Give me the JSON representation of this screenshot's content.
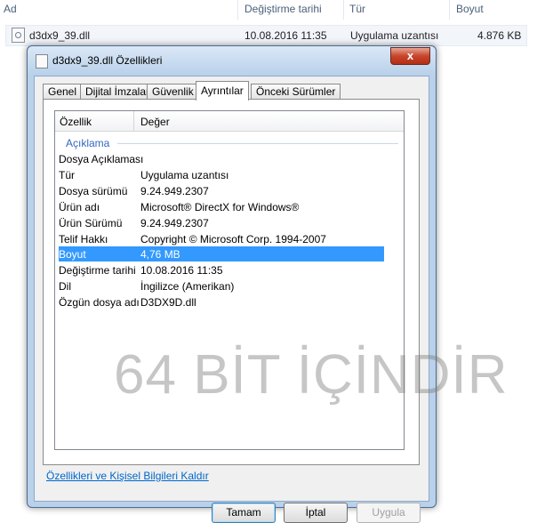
{
  "explorer": {
    "columns": [
      "Ad",
      "Değiştirme tarihi",
      "Tür",
      "Boyut"
    ],
    "row": {
      "name": "d3dx9_39.dll",
      "modified": "10.08.2016 11:35",
      "type": "Uygulama uzantısı",
      "size": "4.876 KB"
    }
  },
  "dialog": {
    "title": "d3dx9_39.dll Özellikleri",
    "close_label": "x",
    "tabs": [
      "Genel",
      "Dijital İmzalar",
      "Güvenlik",
      "Ayrıntılar",
      "Önceki Sürümler"
    ],
    "active_tab": "Ayrıntılar",
    "list_header": {
      "property": "Özellik",
      "value": "Değer"
    },
    "group_label": "Açıklama",
    "properties": [
      {
        "key": "Dosya Açıklaması",
        "value": ""
      },
      {
        "key": "Tür",
        "value": "Uygulama uzantısı"
      },
      {
        "key": "Dosya sürümü",
        "value": "9.24.949.2307"
      },
      {
        "key": "Ürün adı",
        "value": "Microsoft® DirectX for Windows®"
      },
      {
        "key": "Ürün Sürümü",
        "value": "9.24.949.2307"
      },
      {
        "key": "Telif Hakkı",
        "value": "Copyright © Microsoft Corp. 1994-2007"
      },
      {
        "key": "Boyut",
        "value": "4,76 MB"
      },
      {
        "key": "Değiştirme tarihi",
        "value": "10.08.2016 11:35"
      },
      {
        "key": "Dil",
        "value": "İngilizce (Amerikan)"
      },
      {
        "key": "Özgün dosya adı",
        "value": "D3DX9D.dll"
      }
    ],
    "selected_property": "Boyut",
    "remove_link": "Özellikleri ve Kişisel Bilgileri Kaldır",
    "buttons": {
      "ok": "Tamam",
      "cancel": "İptal",
      "apply": "Uygula"
    }
  },
  "watermark": "64 BİT İÇİNDİR",
  "colors": {
    "selection": "#3399ff",
    "group_text": "#3468bf",
    "link": "#0066cc"
  }
}
